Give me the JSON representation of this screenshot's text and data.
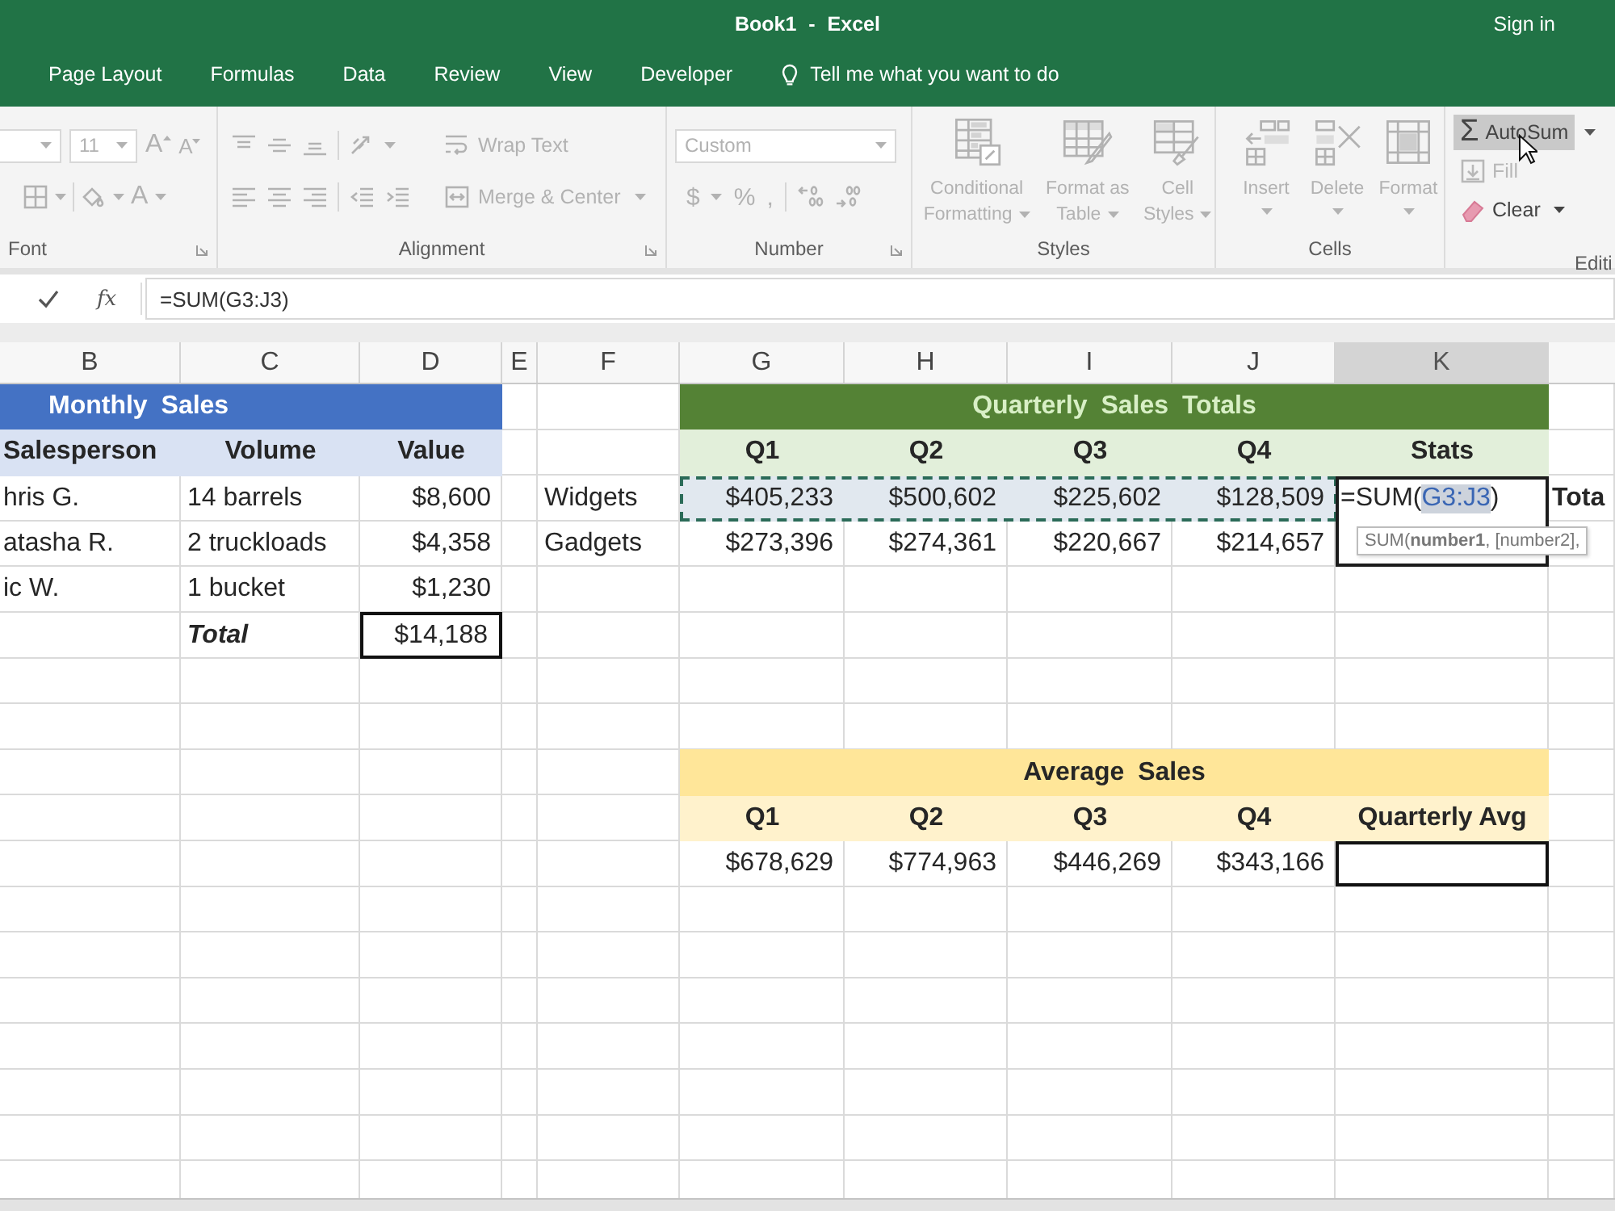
{
  "window": {
    "title": "Book1 - Excel",
    "sign_in": "Sign in"
  },
  "ribbon_tabs": [
    {
      "label": "Page Layout",
      "selected": false
    },
    {
      "label": "Formulas",
      "selected": false
    },
    {
      "label": "Data",
      "selected": false
    },
    {
      "label": "Review",
      "selected": false
    },
    {
      "label": "View",
      "selected": false
    },
    {
      "label": "Developer",
      "selected": false
    }
  ],
  "tell_me": {
    "placeholder": "Tell me what you want to do"
  },
  "ribbon": {
    "groups": [
      {
        "kind": "font",
        "label": "Font",
        "disabled": true,
        "font_size": "11",
        "grow_glyph": "A",
        "shrink_glyph": "A",
        "font_color_glyph": "A"
      },
      {
        "kind": "alignment",
        "label": "Alignment",
        "disabled": true,
        "wrap_text": "Wrap Text",
        "merge_center": "Merge & Center"
      },
      {
        "kind": "number",
        "label": "Number",
        "disabled": true,
        "format": "Custom",
        "currency": "$",
        "percent": "%",
        "comma": ","
      },
      {
        "kind": "styles",
        "label": "Styles",
        "disabled": true,
        "buttons": [
          "Conditional Formatting",
          "Format as Table",
          "Cell Styles"
        ]
      },
      {
        "kind": "cells",
        "label": "Cells",
        "disabled": true,
        "buttons": [
          "Insert",
          "Delete",
          "Format"
        ]
      },
      {
        "kind": "editing",
        "label": "Editi",
        "disabled": false,
        "buttons": [
          {
            "kind": "autosum",
            "glyph": "Σ",
            "label": "AutoSum",
            "hovered": true,
            "disabled": false
          },
          {
            "kind": "fill",
            "label": "Fill",
            "hovered": false,
            "disabled": true
          },
          {
            "kind": "clear",
            "label": "Clear",
            "hovered": false,
            "disabled": false
          }
        ]
      }
    ]
  },
  "formula_bar": {
    "insert_function": "fx",
    "formula": "=SUM(G3:J3)"
  },
  "columns": [
    {
      "label": "B",
      "selected": false
    },
    {
      "label": "C",
      "selected": false
    },
    {
      "label": "D",
      "selected": false
    },
    {
      "label": "E",
      "selected": false
    },
    {
      "label": "F",
      "selected": false
    },
    {
      "label": "G",
      "selected": false
    },
    {
      "label": "H",
      "selected": false
    },
    {
      "label": "I",
      "selected": false
    },
    {
      "label": "J",
      "selected": false
    },
    {
      "label": "K",
      "selected": true
    }
  ],
  "monthly_sales": {
    "title": "Monthly Sales",
    "headers": [
      "Salesperson",
      "Volume",
      "Value"
    ],
    "rows": [
      [
        "hris G.",
        "14 barrels",
        "$8,600"
      ],
      [
        "atasha R.",
        "2 truckloads",
        "$4,358"
      ],
      [
        "ic W.",
        "1 bucket",
        "$1,230"
      ]
    ],
    "total_label": "Total",
    "total": "$14,188"
  },
  "quarterly_sales": {
    "title": "Quarterly Sales Totals",
    "headers": [
      "Q1",
      "Q2",
      "Q3",
      "Q4",
      "Stats"
    ],
    "rows": [
      {
        "label": "Widgets",
        "values": [
          "$405,233",
          "$500,602",
          "$225,602",
          "$128,509"
        ],
        "marquee": true,
        "stats_formula": {
          "prefix": "=SUM(",
          "reference": "G3:J3",
          "suffix": ")"
        },
        "next_cell": "Tota"
      },
      {
        "label": "Gadgets",
        "values": [
          "$273,396",
          "$274,361",
          "$220,667",
          "$214,657"
        ],
        "marquee": false
      }
    ],
    "formula_tooltip": "SUM(**number1**, [number2],"
  },
  "average_sales": {
    "title": "Average Sales",
    "headers": [
      "Q1",
      "Q2",
      "Q3",
      "Q4",
      "Quarterly Avg"
    ],
    "values": [
      "$678,629",
      "$774,963",
      "$446,269",
      "$343,166"
    ]
  }
}
